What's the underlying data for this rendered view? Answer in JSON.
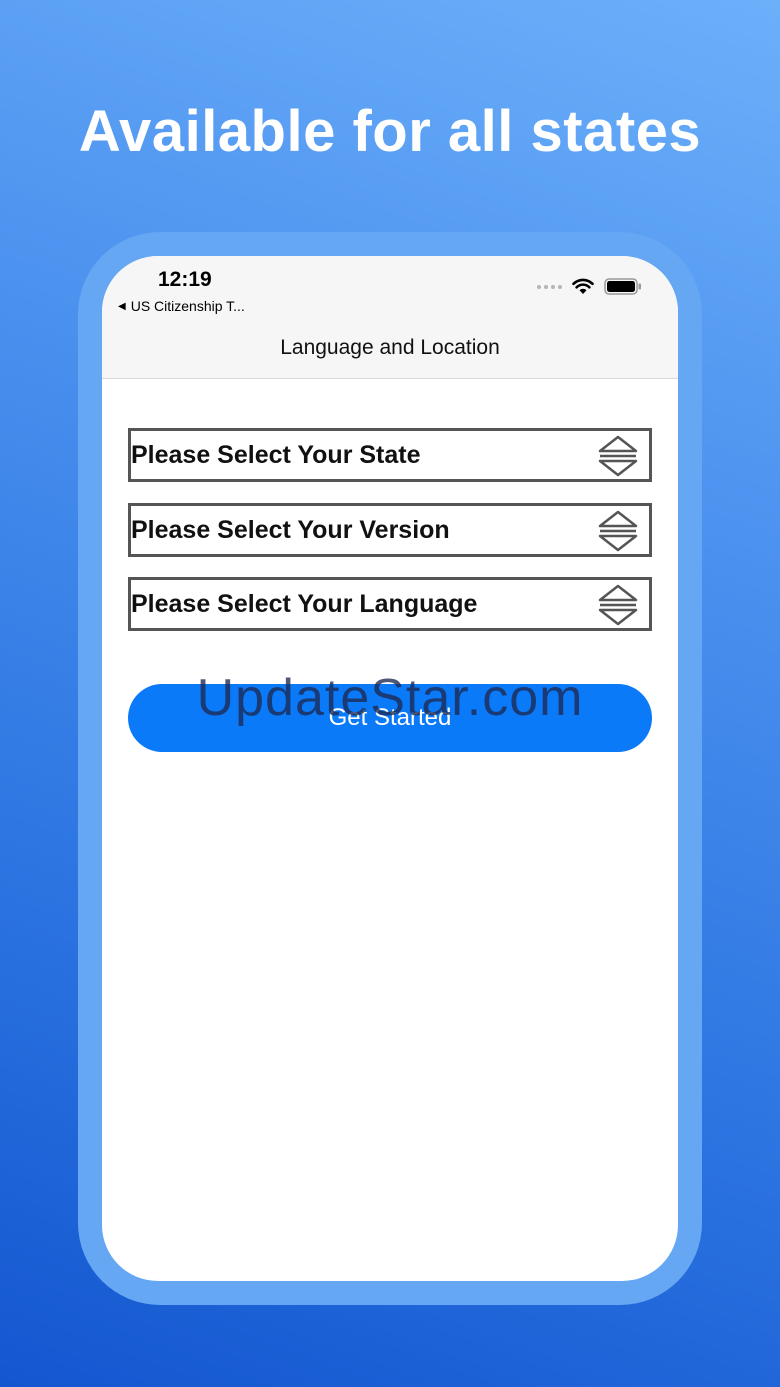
{
  "promo": {
    "headline": "Available for all states"
  },
  "status_bar": {
    "time": "12:19",
    "back_app_label": "US Citizenship T...",
    "icons": [
      "signal-dots-icon",
      "wifi-icon",
      "battery-icon"
    ]
  },
  "nav": {
    "title": "Language and Location"
  },
  "selectors": [
    {
      "label": "Please Select Your State"
    },
    {
      "label": "Please Select Your Version"
    },
    {
      "label": "Please Select Your Language"
    }
  ],
  "actions": {
    "get_started_label": "Get Started"
  },
  "watermark": {
    "text": "UpdateStar.com"
  },
  "colors": {
    "background_top": "#6cb0fa",
    "background_bottom": "#1456d0",
    "phone_frame": "#66a7f3",
    "button": "#0a7af9",
    "select_border": "#555555"
  }
}
